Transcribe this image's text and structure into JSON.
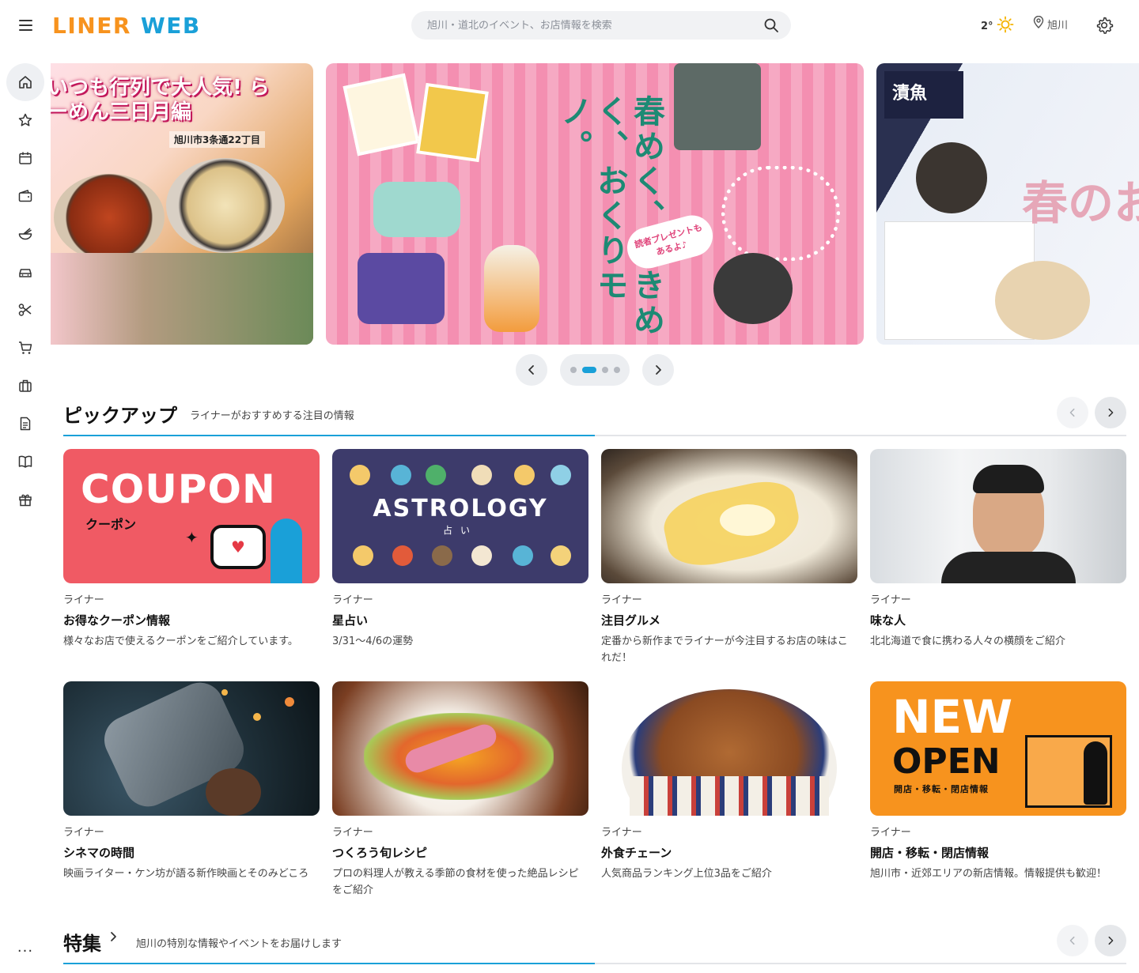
{
  "header": {
    "logo_part1": "LINER",
    "logo_part2": "WEB",
    "search_placeholder": "旭川・道北のイベント、お店情報を検索",
    "temperature": "2°",
    "location": "旭川"
  },
  "sidebar": {
    "items": [
      {
        "name": "home",
        "icon": "home-icon"
      },
      {
        "name": "favorites",
        "icon": "star-icon"
      },
      {
        "name": "events",
        "icon": "calendar-icon"
      },
      {
        "name": "wallet",
        "icon": "wallet-icon"
      },
      {
        "name": "gourmet",
        "icon": "bowl-icon"
      },
      {
        "name": "car",
        "icon": "car-icon"
      },
      {
        "name": "beauty",
        "icon": "scissors-icon"
      },
      {
        "name": "shopping",
        "icon": "cart-icon"
      },
      {
        "name": "jobs",
        "icon": "briefcase-icon"
      },
      {
        "name": "documents",
        "icon": "document-icon"
      },
      {
        "name": "books",
        "icon": "book-icon"
      },
      {
        "name": "gifts",
        "icon": "gift-icon"
      }
    ],
    "more_label": "..."
  },
  "hero": {
    "slides": [
      {
        "title": "いつも行列で大人気! らーめん三日月編",
        "sub": "旭川市3条通22丁目"
      },
      {
        "title": "春めく、ときめく、おくりモノ。",
        "badge": "読者プレゼントもあるよ♪"
      },
      {
        "title": "春のお"
      }
    ],
    "active_index": 1,
    "dot_count": 4
  },
  "pickup": {
    "title": "ピックアップ",
    "desc": "ライナーがおすすめする注目の情報",
    "cards": [
      {
        "thumb": "coupon",
        "thumb_text": "COUPON",
        "thumb_sub": "クーポン",
        "category": "ライナー",
        "title": "お得なクーポン情報",
        "desc": "様々なお店で使えるクーポンをご紹介しています。"
      },
      {
        "thumb": "astro",
        "thumb_text": "ASTROLOGY",
        "thumb_sub": "占い",
        "category": "ライナー",
        "title": "星占い",
        "desc": "3/31〜4/6の運勢"
      },
      {
        "thumb": "gourmet",
        "category": "ライナー",
        "title": "注目グルメ",
        "desc": "定番から新作までライナーが今注目するお店の味はこれだ！"
      },
      {
        "thumb": "person",
        "category": "ライナー",
        "title": "味な人",
        "desc": "北北海道で食に携わる人々の横顔をご紹介"
      },
      {
        "thumb": "cinema",
        "category": "ライナー",
        "title": "シネマの時間",
        "desc": "映画ライター・ケン坊が語る新作映画とそのみどころ"
      },
      {
        "thumb": "recipe",
        "category": "ライナー",
        "title": "つくろう旬レシピ",
        "desc": "プロの料理人が教える季節の食材を使った絶品レシピをご紹介"
      },
      {
        "thumb": "chain",
        "category": "ライナー",
        "title": "外食チェーン",
        "desc": "人気商品ランキング上位3品をご紹介"
      },
      {
        "thumb": "open",
        "thumb_text": "NEW",
        "thumb_text2": "OPEN",
        "thumb_sub": "開店・移転・閉店情報",
        "category": "ライナー",
        "title": "開店・移転・閉店情報",
        "desc": "旭川市・近郊エリアの新店情報。情報提供も歓迎！"
      }
    ]
  },
  "feature": {
    "title": "特集",
    "desc": "旭川の特別な情報やイベントをお届けします"
  },
  "colors": {
    "accent": "#1aa0d8",
    "logo_orange": "#f7931e",
    "coupon_red": "#f05a64",
    "astro_navy": "#3d3b6b"
  }
}
